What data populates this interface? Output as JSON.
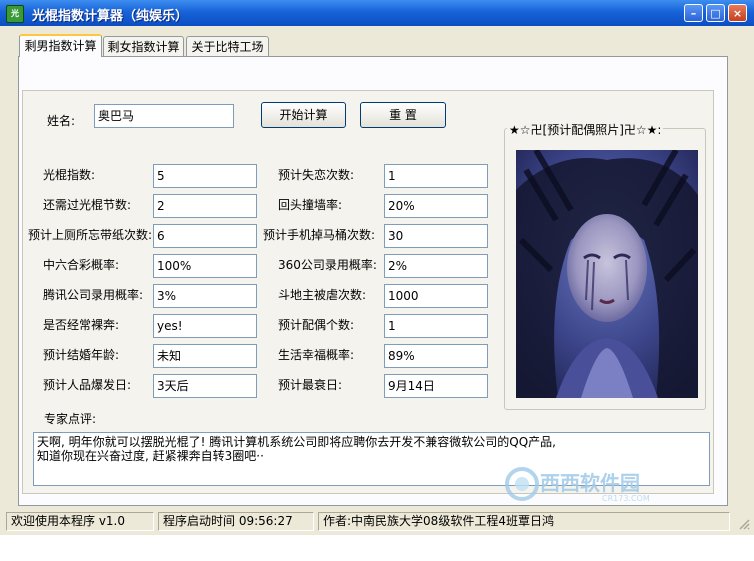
{
  "window": {
    "title": "光棍指数计算器（纯娱乐）"
  },
  "tabs": [
    {
      "label": "剩男指数计算",
      "active": true
    },
    {
      "label": "剩女指数计算",
      "active": false
    },
    {
      "label": "关于比特工场",
      "active": false
    }
  ],
  "name_row": {
    "label": "姓名:",
    "value": "奥巴马"
  },
  "buttons": {
    "start": "开始计算",
    "reset": "重 置"
  },
  "left_fields": [
    {
      "label": "光棍指数:",
      "value": "5"
    },
    {
      "label": "还需过光棍节数:",
      "value": "2"
    },
    {
      "label": "预计上厕所忘带纸次数:",
      "value": "6"
    },
    {
      "label": "中六合彩概率:",
      "value": "100%"
    },
    {
      "label": "腾讯公司录用概率:",
      "value": "3%"
    },
    {
      "label": "是否经常裸奔:",
      "value": "yes!"
    },
    {
      "label": "预计结婚年龄:",
      "value": "未知"
    },
    {
      "label": "预计人品爆发日:",
      "value": "3天后"
    }
  ],
  "right_fields": [
    {
      "label": "预计失恋次数:",
      "value": "1"
    },
    {
      "label": "回头撞墙率:",
      "value": "20%"
    },
    {
      "label": "预计手机掉马桶次数:",
      "value": "30"
    },
    {
      "label": "360公司录用概率:",
      "value": "2%"
    },
    {
      "label": "斗地主被虐次数:",
      "value": "1000"
    },
    {
      "label": "预计配偶个数:",
      "value": "1"
    },
    {
      "label": "生活幸福概率:",
      "value": "89%"
    },
    {
      "label": "预计最衰日:",
      "value": "9月14日"
    }
  ],
  "photo": {
    "caption": "★☆卍[预计配偶照片]卍☆★:"
  },
  "comment": {
    "label": "专家点评:",
    "line1": "天啊, 明年你就可以摆脱光棍了! 腾讯计算机系统公司即将应聘你去开发不兼容微软公司的QQ产品,",
    "line2": "知道你现在兴奋过度, 赶紧裸奔自转3圈吧··"
  },
  "statusbar": {
    "welcome": "欢迎使用本程序 v1.0",
    "start_time": "程序启动时间 09:56:27",
    "author": "作者:中南民族大学08级软件工程4班覃日鸿"
  },
  "watermark": {
    "text": "西西软件园",
    "sub": "CR173.COM"
  },
  "colors": {
    "titlebar": "#1763d8",
    "window": "#ece9d8",
    "tab_highlight": "#ffc83c"
  }
}
